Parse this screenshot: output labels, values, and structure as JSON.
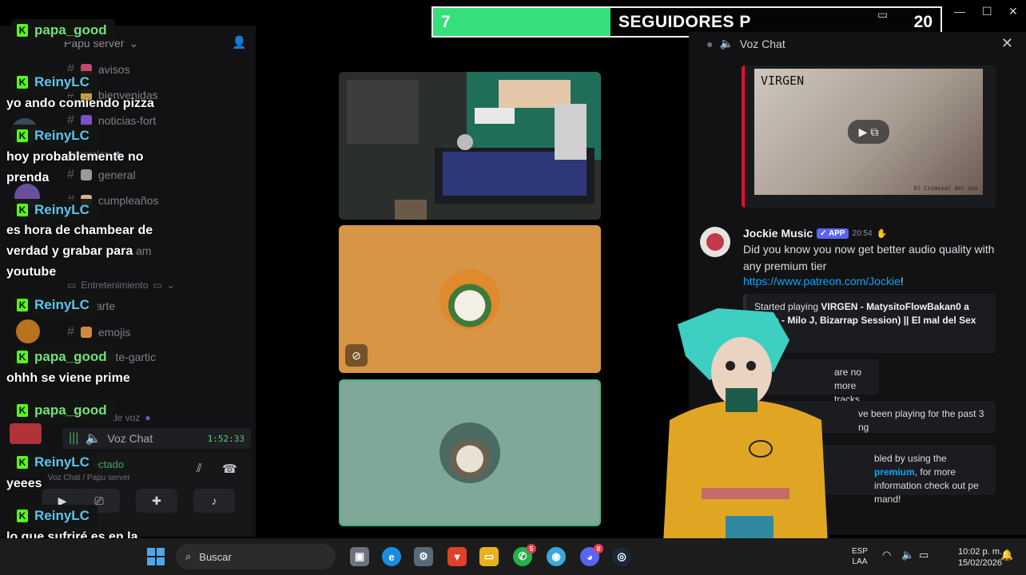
{
  "goal": {
    "current": "7",
    "label": "SEGUIDORES P",
    "target": "20",
    "progress": 0.35,
    "fill_color": "#35e07a"
  },
  "sidebar": {
    "server_name": "Papu server",
    "channels": [
      {
        "name": "avisos"
      },
      {
        "name": "bienvenidas"
      },
      {
        "name": "noticias-fort"
      },
      {
        "name": "generales"
      },
      {
        "name": "general"
      },
      {
        "name": "cumpleaños"
      },
      {
        "name": "am"
      },
      {
        "name": "Entretenimiento"
      },
      {
        "name": "arte"
      },
      {
        "name": "emojis"
      },
      {
        "name": "arte-gartic"
      },
      {
        "name": "de voz"
      }
    ],
    "voice_channel": "Voz Chat",
    "voice_timer": "1:52:33",
    "connection_status": "ectado",
    "connection_path": "Voz Chat / Papu server"
  },
  "chat": [
    {
      "user": "papa_good",
      "text": ""
    },
    {
      "user": "ReinyLC",
      "text": "yo ando comiendo pizza"
    },
    {
      "user": "ReinyLC",
      "text": "hoy probablemente no prenda"
    },
    {
      "user": "ReinyLC",
      "text": "es hora de chambear de verdad y grabar para youtube"
    },
    {
      "user": "ReinyLC",
      "text": ""
    },
    {
      "user": "papa_good",
      "text": "ohhh se viene prime"
    },
    {
      "user": "papa_good",
      "text": ""
    },
    {
      "user": "ReinyLC",
      "text": "yeees"
    },
    {
      "user": "ReinyLC",
      "text": "lo que sufriré es en la edici´pon"
    }
  ],
  "right_panel": {
    "title": "Voz Chat",
    "embed_title": "VIRGEN",
    "embed_sub": "El Criminal del Sex",
    "bot": {
      "name": "Jockie Music",
      "badge": "APP",
      "time": "20:54",
      "text": "Did you know you now get better audio quality with any premium tier",
      "link": "https://www.patreon.com/Jockie",
      "link_end": "!"
    },
    "now_playing_prefix": "Started playing ",
    "now_playing": "VIRGEN - MatysitoFlowBakan0 a Fruto - Milo J, Bizarrap Session) || El mal del Sex",
    "no_more": "are no more tracks",
    "playing_for": "ve been playing for the past 3 ng",
    "premium_pre": "bled by using the ",
    "premium_word": "premium",
    "premium_post": ", for more information check out pe mand!"
  },
  "taskbar": {
    "search_placeholder": "Buscar",
    "lang_top": "ESP",
    "lang_bottom": "LAA",
    "time": "10:02 p. m.",
    "date": "15/02/2026",
    "badge_whatsapp": "5",
    "badge_discord": "8"
  }
}
